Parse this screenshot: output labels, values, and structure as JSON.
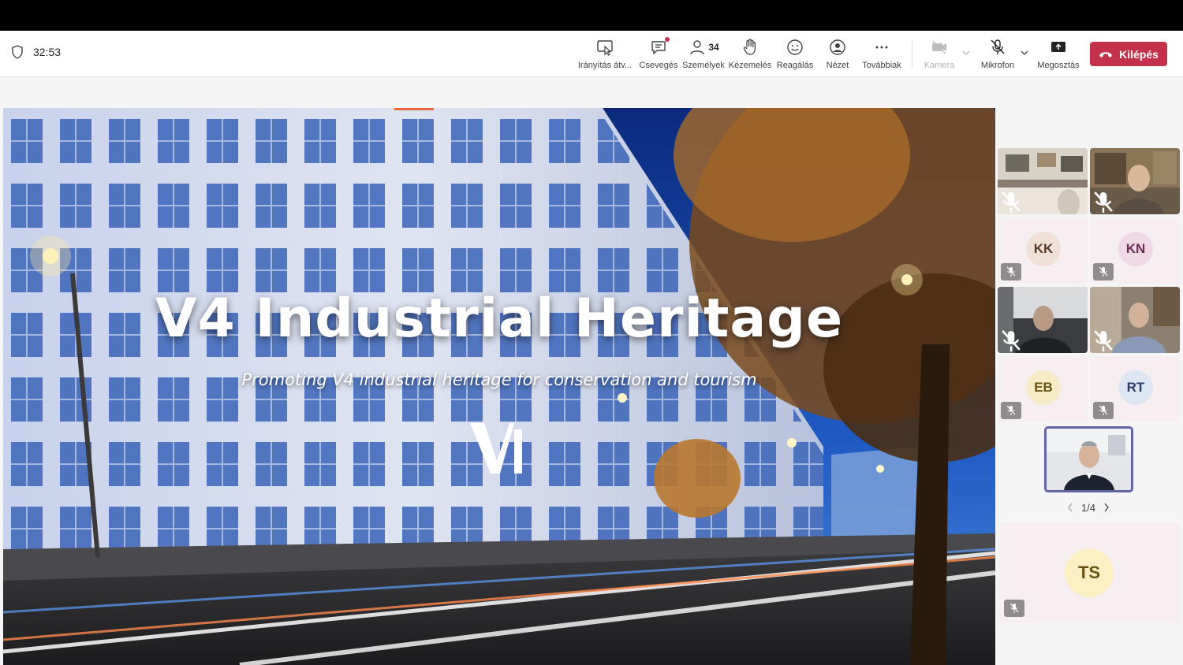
{
  "toolbar": {
    "timer": "32:53",
    "buttons": [
      {
        "label": "Irányítás átv...",
        "icon": "screen-pointer-icon"
      },
      {
        "label": "Csevegés",
        "icon": "chat-icon"
      },
      {
        "label": "Személyek",
        "icon": "people-icon",
        "count": "34"
      },
      {
        "label": "Kézemelés",
        "icon": "raise-hand-icon"
      },
      {
        "label": "Reagálás",
        "icon": "smiley-icon"
      },
      {
        "label": "Nézet",
        "icon": "view-icon"
      },
      {
        "label": "Továbbiak",
        "icon": "more-icon"
      },
      {
        "label": "Kamera",
        "icon": "camera-off-icon"
      },
      {
        "label": "Mikrofon",
        "icon": "mic-off-icon"
      },
      {
        "label": "Megosztás",
        "icon": "share-icon"
      }
    ],
    "leave_label": "Kilépés"
  },
  "slide": {
    "title": "V4 Industrial Heritage",
    "subtitle": "Promoting V4 industrial heritage for conservation and tourism"
  },
  "participants": {
    "avatars": [
      {
        "initials": "KK",
        "bg": "#f1e0d6",
        "fg": "#5a3a2a"
      },
      {
        "initials": "KN",
        "bg": "#f1d8e6",
        "fg": "#6b2a53"
      },
      {
        "initials": "EB",
        "bg": "#f7ecc7",
        "fg": "#6a5210"
      },
      {
        "initials": "RT",
        "bg": "#dfe6f3",
        "fg": "#2a3f6b"
      }
    ],
    "featured": {
      "initials": "TS",
      "bg": "#fbefc3",
      "fg": "#6a5210"
    },
    "page": "1/4"
  },
  "colors": {
    "accent": "#6264a7",
    "leave": "#c4314b"
  }
}
